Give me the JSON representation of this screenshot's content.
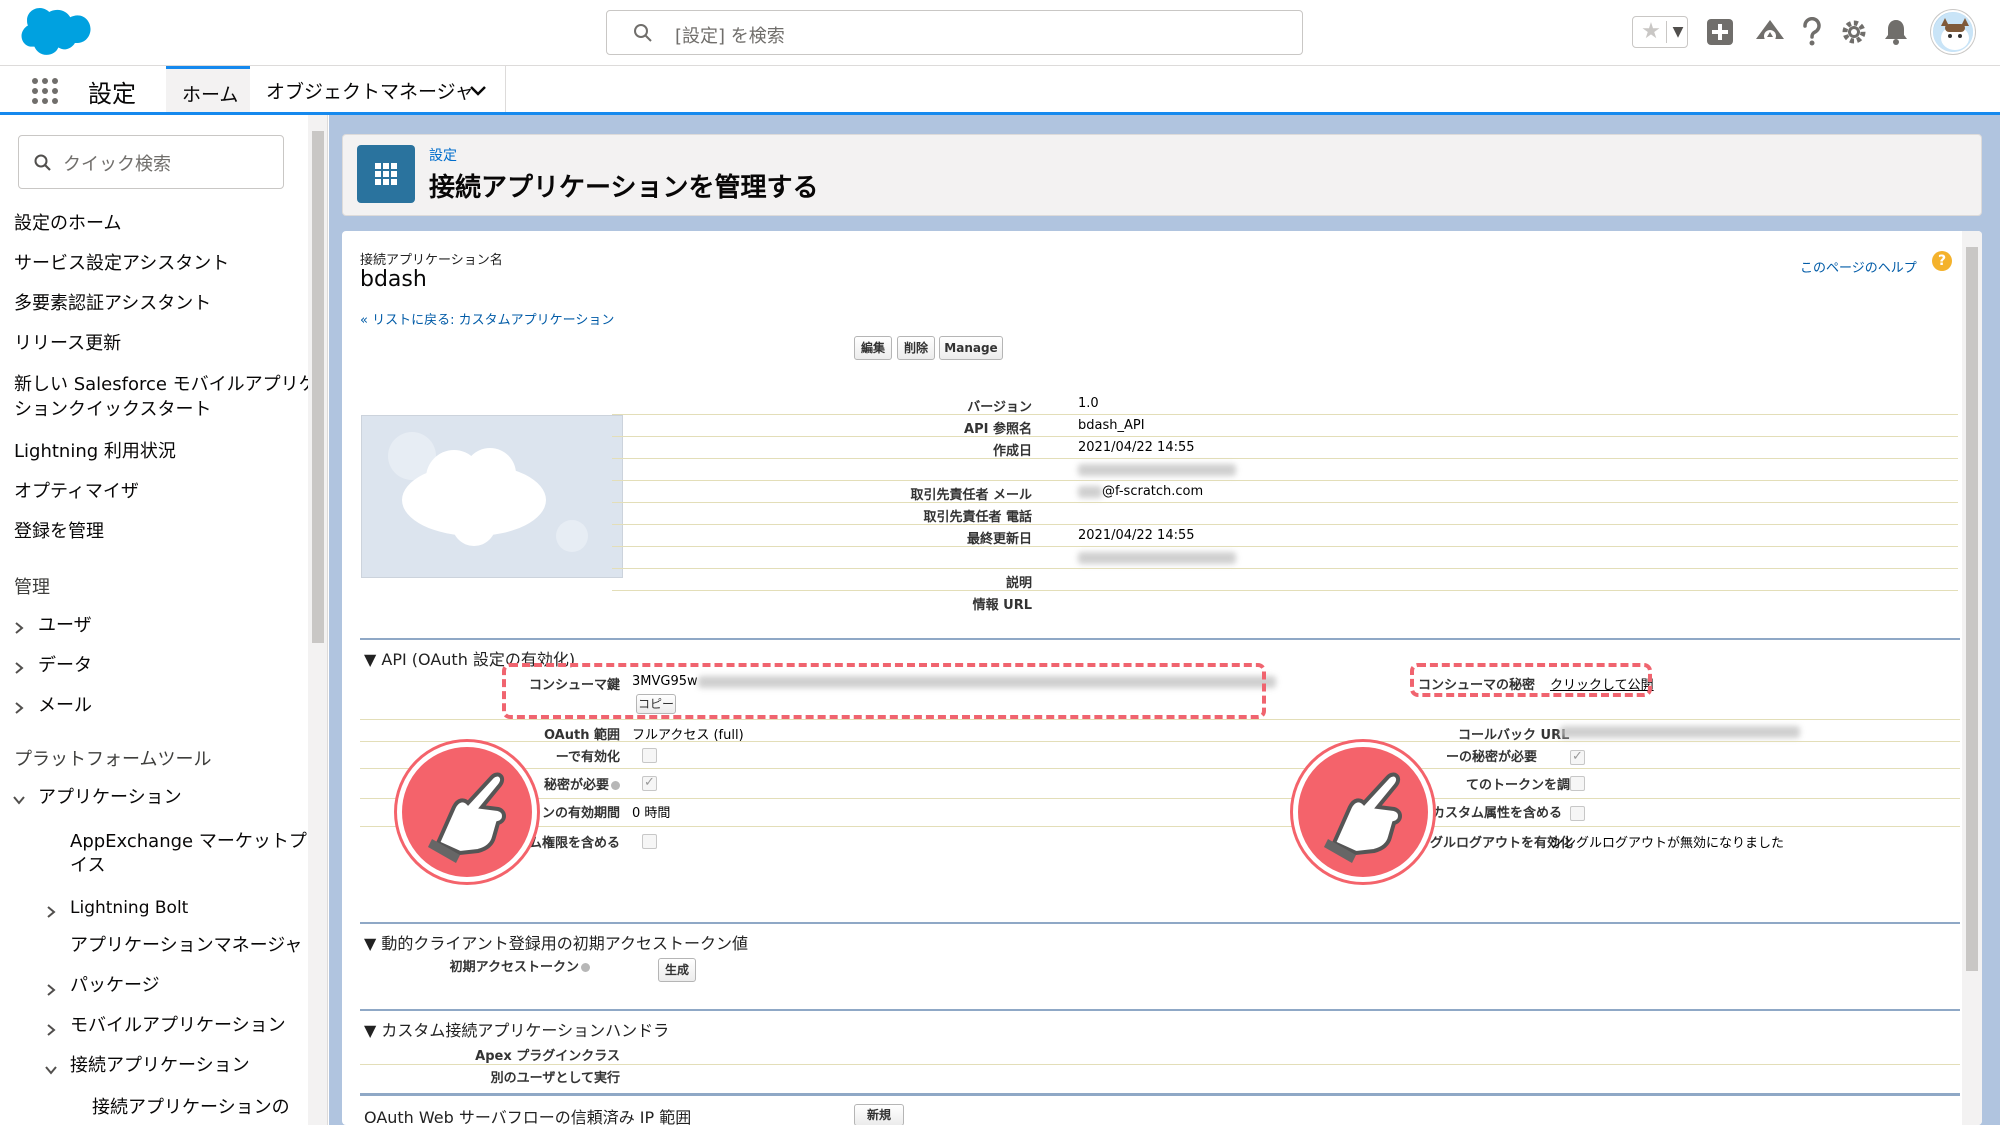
{
  "header": {
    "search_placeholder": "[設定] を検索"
  },
  "nav": {
    "app_name": "設定",
    "tabs": [
      {
        "label": "ホーム"
      },
      {
        "label": "オブジェクトマネージャ"
      }
    ]
  },
  "sidebar": {
    "quick_search_placeholder": "クイック検索",
    "items": [
      "設定のホーム",
      "サービス設定アシスタント",
      "多要素認証アシスタント",
      "リリース更新",
      "新しい Salesforce モバイルアプリケー",
      "ションクイックスタート",
      "Lightning 利用状況",
      "オプティマイザ",
      "登録を管理"
    ],
    "admin_heading": "管理",
    "admin_items": [
      "ユーザ",
      "データ",
      "メール"
    ],
    "platform_heading": "プラットフォームツール",
    "app_heading": "アプリケーション",
    "app_items": {
      "appexchange_1": "AppExchange マーケットプレ",
      "appexchange_2": "イス",
      "bolt": "Lightning Bolt",
      "app_manager": "アプリケーションマネージャ",
      "packages": "パッケージ",
      "mobile_apps": "モバイルアプリケーション",
      "connected_apps": "接続アプリケーション",
      "connected_apps_child": "接続アプリケーションの"
    }
  },
  "page": {
    "breadcrumb": "設定",
    "title": "接続アプリケーションを管理する",
    "app_name_label": "接続アプリケーション名",
    "app_name": "bdash",
    "help_link": "このページのヘルプ",
    "help_icon": "?",
    "back_link": "« リストに戻る: カスタムアプリケーション",
    "buttons": {
      "edit": "編集",
      "delete": "削除",
      "manage": "Manage"
    }
  },
  "details": [
    {
      "label": "バージョン",
      "value": "1.0"
    },
    {
      "label": "API 参照名",
      "value": "bdash_API"
    },
    {
      "label": "作成日",
      "value": "2021/04/22 14:55"
    },
    {
      "label": "",
      "value": ""
    },
    {
      "label": "取引先責任者 メール",
      "value": "@f-scratch.com"
    },
    {
      "label": "取引先責任者 電話",
      "value": ""
    },
    {
      "label": "最終更新日",
      "value": "2021/04/22 14:55"
    },
    {
      "label": "",
      "value": ""
    },
    {
      "label": "説明",
      "value": ""
    },
    {
      "label": "情報 URL",
      "value": ""
    }
  ],
  "api_section": {
    "title": "▼ API (OAuth 設定の有効化)",
    "consumer_key_label": "コンシューマ鍵",
    "consumer_key_value": "3MVG95w",
    "copy_button": "コピー",
    "consumer_secret_label": "コンシューマの秘密",
    "consumer_secret_link": "クリックして公開",
    "oauth_scope_label": "OAuth 範囲",
    "oauth_scope_value": "フルアクセス (full)",
    "callback_label": "コールバック URL",
    "left_row3_label": "ーで有効化",
    "right_row3_label": "ーの秘密が必要",
    "left_row4_label": "秘密が必要",
    "right_row4_label": "てのトークンを調査",
    "left_row5_label": "ンの有効期間",
    "left_row5_value": "0 時間",
    "right_row5_label": "カスタム属性を含める",
    "left_row6_label": "カスタム権限を含める",
    "right_row6_label": "シングルログアウトを有効化",
    "right_row6_value": "シングルログアウトが無効になりました"
  },
  "dynamic_section": {
    "title": "▼ 動的クライアント登録用の初期アクセストークン値",
    "label": "初期アクセストークン",
    "button": "生成"
  },
  "handler_section": {
    "title": "▼ カスタム接続アプリケーションハンドラ",
    "row1": "Apex プラグインクラス",
    "row2": "別のユーザとして実行"
  },
  "ip_section": {
    "title": "OAuth Web サーバフローの信頼済み IP 範囲",
    "button": "新規"
  }
}
